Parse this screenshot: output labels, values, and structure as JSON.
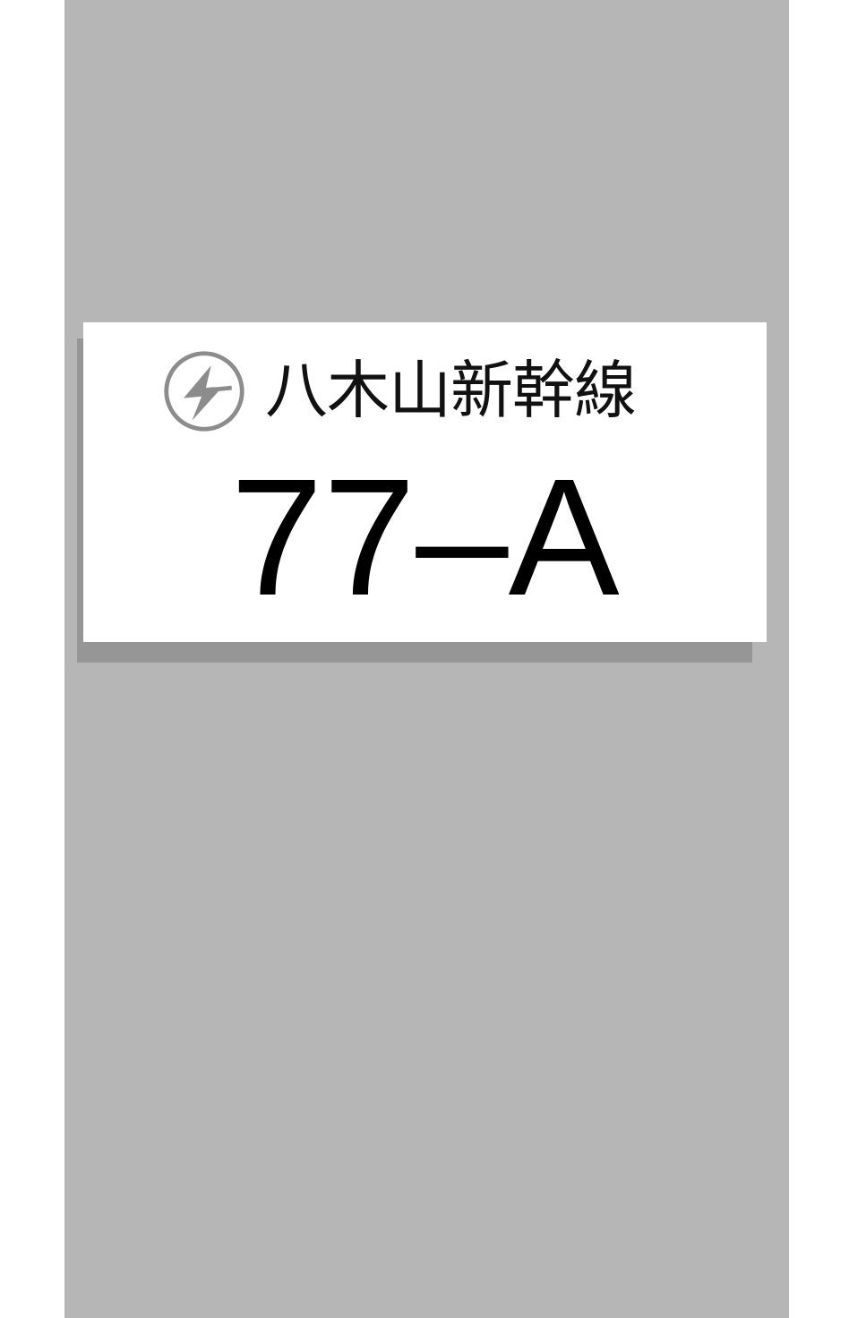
{
  "sign": {
    "line_name": "八木山新幹線",
    "platform_code": "77–A",
    "logo_icon": "lightning-circle-icon"
  },
  "colors": {
    "wall": "#b6b6b6",
    "sign_background": "#ffffff",
    "sign_shadow": "#969696",
    "logo": "#8c8c8c",
    "text": "#000000"
  }
}
